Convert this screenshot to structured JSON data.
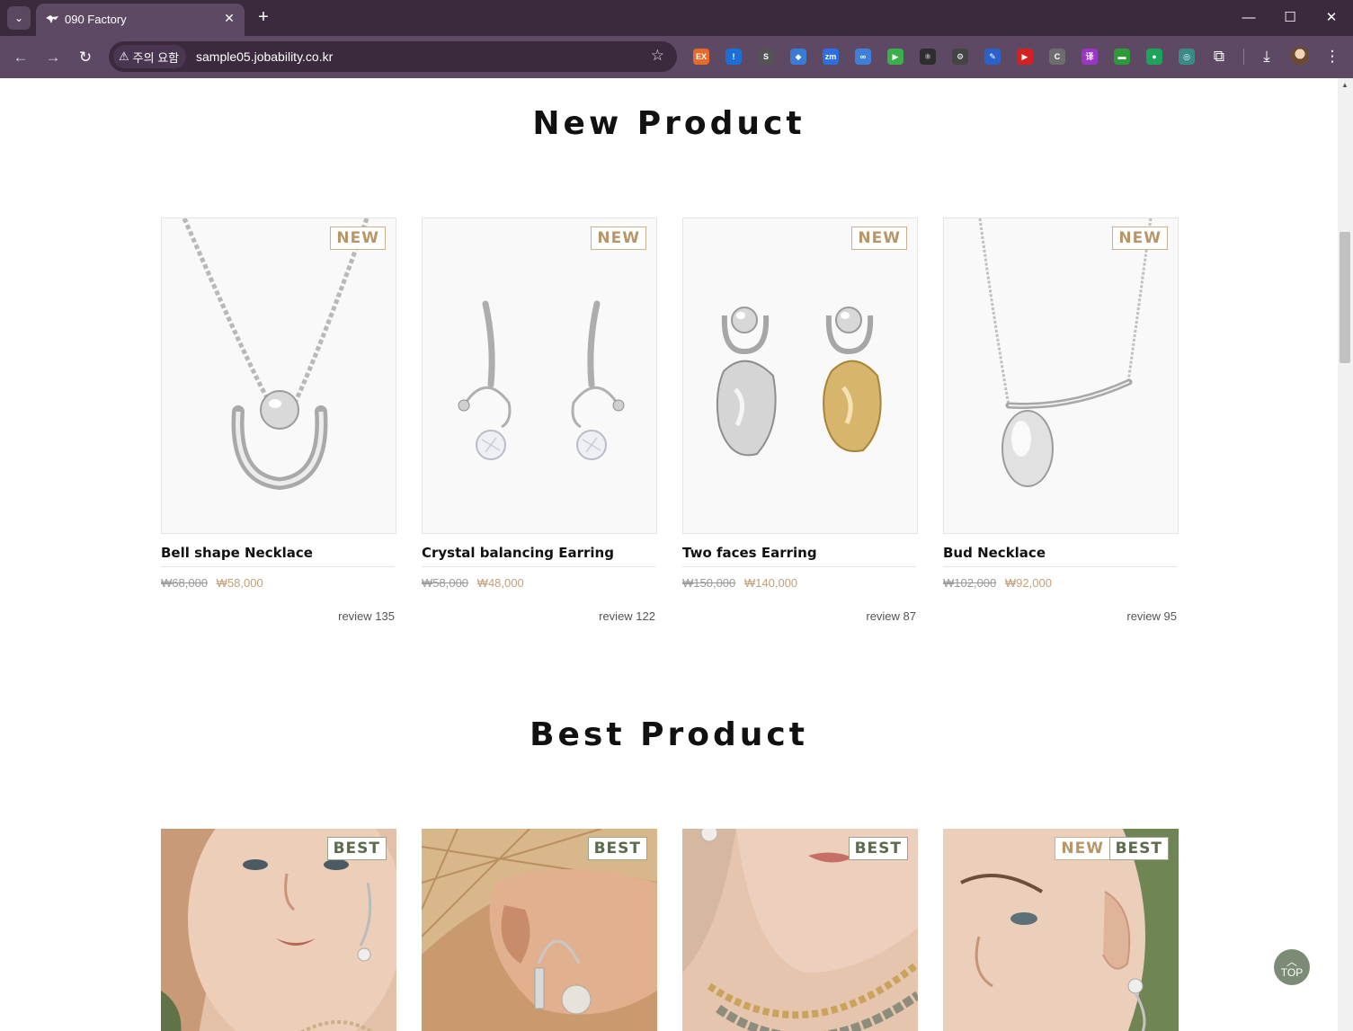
{
  "browser": {
    "tab_title": "090 Factory",
    "security_chip": "주의 요함",
    "url": "sample05.jobability.co.kr",
    "extensions": [
      {
        "name": "ex-icon",
        "label": "EX",
        "color": "#e46b2b"
      },
      {
        "name": "shield-icon",
        "label": "!",
        "color": "#1b6fd6"
      },
      {
        "name": "s-icon",
        "label": "S",
        "color": "#545454"
      },
      {
        "name": "cube-icon",
        "label": "◆",
        "color": "#3a7bd5"
      },
      {
        "name": "zm-icon",
        "label": "zm",
        "color": "#2d6fe0"
      },
      {
        "name": "link-icon",
        "label": "∞",
        "color": "#3f7fd9"
      },
      {
        "name": "play-icon",
        "label": "▶",
        "color": "#3bb04a"
      },
      {
        "name": "react-icon",
        "label": "⚛",
        "color": "#2e2e2e"
      },
      {
        "name": "gear-ext-icon",
        "label": "⚙",
        "color": "#444"
      },
      {
        "name": "pen-icon",
        "label": "✎",
        "color": "#2a62c9"
      },
      {
        "name": "youtube-icon",
        "label": "▶",
        "color": "#d42020"
      },
      {
        "name": "c-icon",
        "label": "C",
        "color": "#6d6d6d"
      },
      {
        "name": "translate-icon",
        "label": "译",
        "color": "#9b35c8"
      },
      {
        "name": "card-icon",
        "label": "▬",
        "color": "#2f9a3a"
      },
      {
        "name": "chat-icon",
        "label": "●",
        "color": "#1da35a"
      },
      {
        "name": "globe-icon",
        "label": "◎",
        "color": "#3c8a86"
      }
    ]
  },
  "new_section": {
    "title": "New Product",
    "products": [
      {
        "name": "Bell shape Necklace",
        "old_price": "₩68,000",
        "price": "₩58,000",
        "review": "review 135",
        "badges": [
          "NEW"
        ]
      },
      {
        "name": "Crystal balancing Earring",
        "old_price": "₩58,000",
        "price": "₩48,000",
        "review": "review 122",
        "badges": [
          "NEW"
        ]
      },
      {
        "name": "Two faces Earring",
        "old_price": "₩150,000",
        "price": "₩140,000",
        "review": "review 87",
        "badges": [
          "NEW"
        ]
      },
      {
        "name": "Bud Necklace",
        "old_price": "₩102,000",
        "price": "₩92,000",
        "review": "review 95",
        "badges": [
          "NEW"
        ]
      }
    ]
  },
  "best_section": {
    "title": "Best Product",
    "products": [
      {
        "badges": [
          "BEST"
        ]
      },
      {
        "badges": [
          "BEST"
        ]
      },
      {
        "badges": [
          "BEST"
        ]
      },
      {
        "badges": [
          "NEW",
          "BEST"
        ]
      }
    ]
  },
  "top_button": "TOP"
}
